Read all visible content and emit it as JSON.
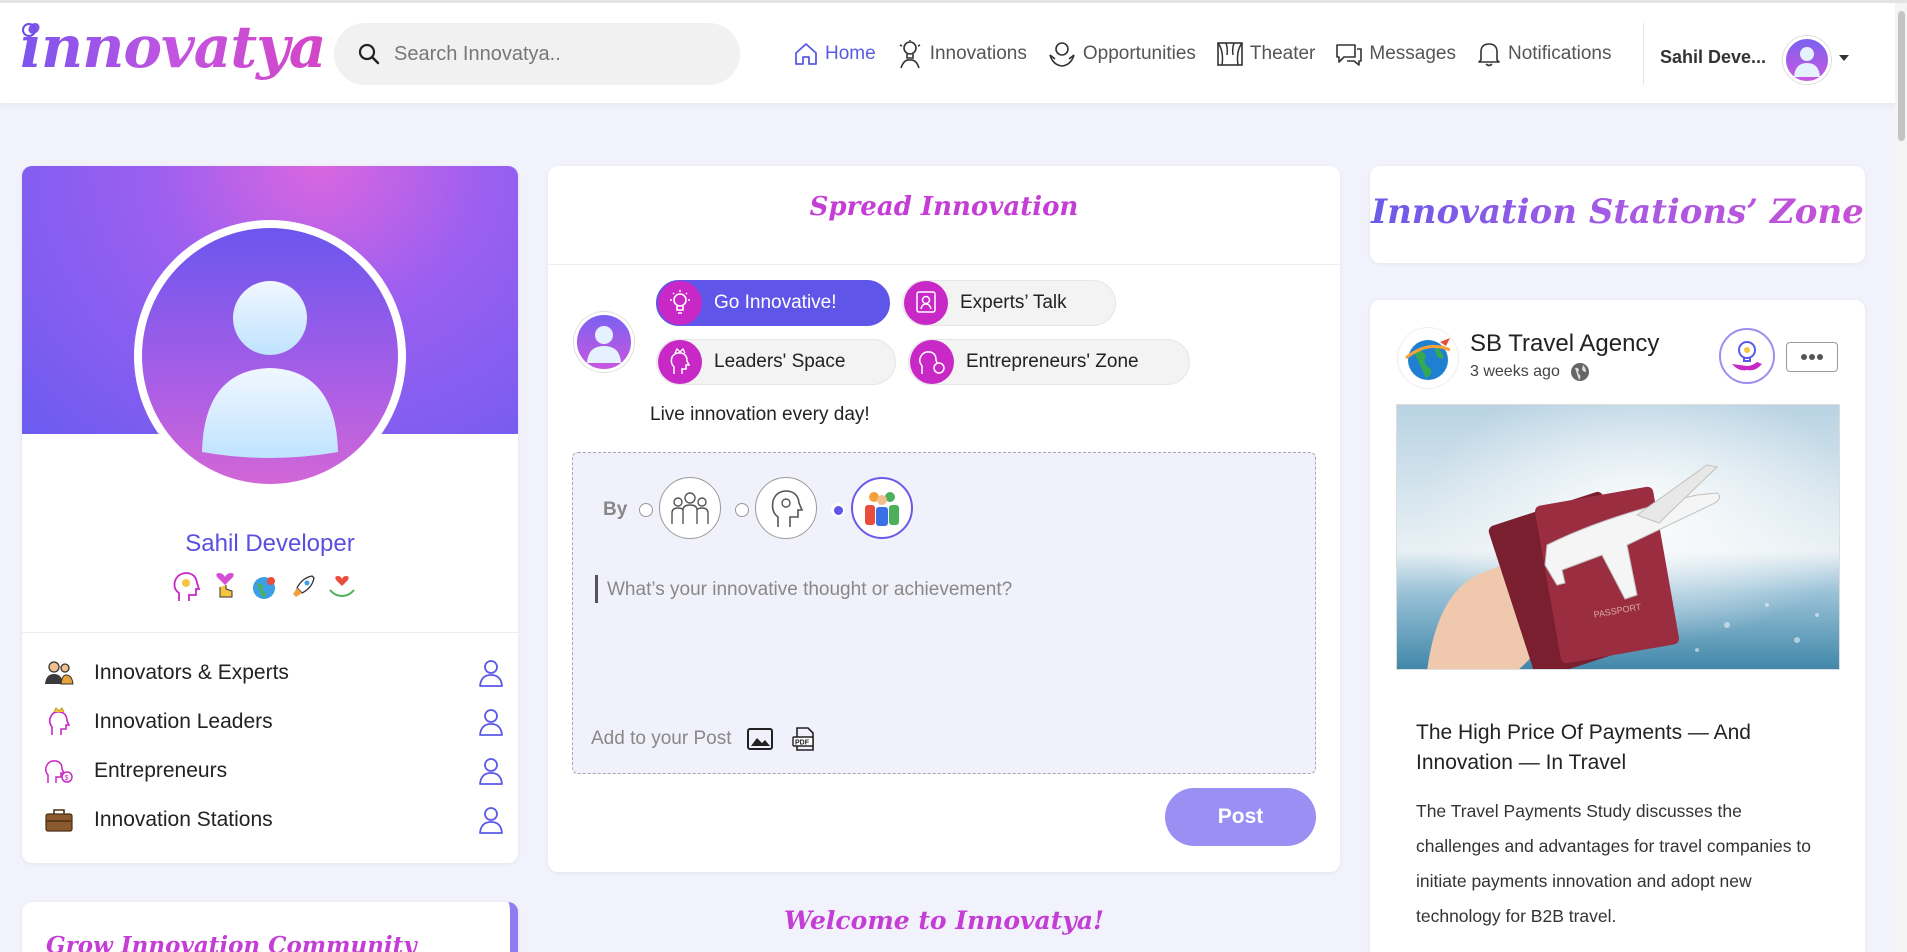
{
  "header": {
    "logo": "innovatya",
    "search": {
      "placeholder": "Search Innovatya.."
    },
    "nav": [
      {
        "label": "Home",
        "icon": "home-icon",
        "active": true
      },
      {
        "label": "Innovations",
        "icon": "innovator-icon"
      },
      {
        "label": "Opportunities",
        "icon": "opportunities-icon"
      },
      {
        "label": "Theater",
        "icon": "theater-icon"
      },
      {
        "label": "Messages",
        "icon": "messages-icon"
      },
      {
        "label": "Notifications",
        "icon": "bell-icon"
      }
    ],
    "user": {
      "name": "Sahil Deve..."
    }
  },
  "profile": {
    "name": "Sahil Developer",
    "badges": [
      "innovator-badge",
      "heart-hand-badge",
      "globe-badge",
      "rocket-badge",
      "hands-heart-badge"
    ],
    "menu": [
      {
        "label": "Innovators & Experts",
        "icon": "people-icon"
      },
      {
        "label": "Innovation Leaders",
        "icon": "leader-icon"
      },
      {
        "label": "Entrepreneurs",
        "icon": "entrepreneur-icon"
      },
      {
        "label": "Innovation Stations",
        "icon": "briefcase-icon"
      }
    ]
  },
  "grow": {
    "title": "Grow Innovation Community"
  },
  "composer": {
    "title": "Spread Innovation",
    "categories": [
      {
        "label": "Go Innovative!",
        "active": true
      },
      {
        "label": "Experts’ Talk"
      },
      {
        "label": "Leaders' Space"
      },
      {
        "label": "Entrepreneurs' Zone"
      }
    ],
    "tagline": "Live innovation every day!",
    "by_label": "By",
    "placeholder": "What’s your innovative thought or achievement?",
    "add_to_post": "Add to your Post",
    "post_button": "Post"
  },
  "welcome": "Welcome to Innovatya!",
  "zone": {
    "title": "Innovation Stations’ Zone"
  },
  "feed": {
    "author": "SB Travel Agency",
    "time": "3 weeks ago",
    "headline": "The High Price Of Payments — And Innovation — In Travel",
    "body": "The Travel Payments Study discusses the challenges and advantages for travel companies to initiate payments innovation and adopt new technology for B2B travel."
  },
  "colors": {
    "accent": "#5f55e8",
    "magenta": "#c43ed6",
    "post_button": "#9b8ff4"
  }
}
